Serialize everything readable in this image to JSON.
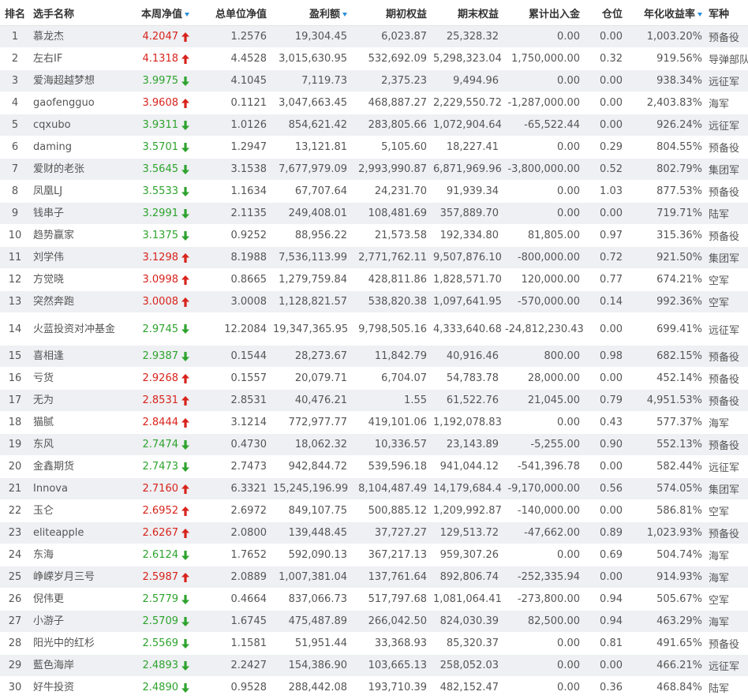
{
  "headers": {
    "rank": "排名",
    "name": "选手名称",
    "week_nav": "本周净值",
    "unit_nav": "总单位净值",
    "profit": "盈利额",
    "initial_equity": "期初权益",
    "final_equity": "期末权益",
    "cum_flow": "累计出入金",
    "position": "仓位",
    "annual_return": "年化收益率",
    "army": "军种"
  },
  "sort_icon": "sort-down-icon",
  "colors": {
    "up": "#d8231c",
    "down": "#2ea32e",
    "sort": "#2a8fd8",
    "stripe": "#eef0f3"
  },
  "rows": [
    {
      "rank": "1",
      "name": "慕龙杰",
      "week": "4.2047",
      "dir": "up",
      "unit": "1.2576",
      "profit": "19,304.45",
      "init": "6,023.87",
      "end": "25,328.32",
      "flow": "0.00",
      "pos": "0.00",
      "ann": "1,003.20%",
      "army": "预备役"
    },
    {
      "rank": "2",
      "name": "左右IF",
      "week": "4.1318",
      "dir": "up",
      "unit": "4.4528",
      "profit": "3,015,630.95",
      "init": "532,692.09",
      "end": "5,298,323.04",
      "flow": "1,750,000.00",
      "pos": "0.32",
      "ann": "919.56%",
      "army": "导弹部队"
    },
    {
      "rank": "3",
      "name": "爱海超越梦想",
      "week": "3.9975",
      "dir": "down",
      "unit": "4.1045",
      "profit": "7,119.73",
      "init": "2,375.23",
      "end": "9,494.96",
      "flow": "0.00",
      "pos": "0.00",
      "ann": "938.34%",
      "army": "远征军"
    },
    {
      "rank": "4",
      "name": "gaofengguo",
      "week": "3.9608",
      "dir": "up",
      "unit": "0.1121",
      "profit": "3,047,663.45",
      "init": "468,887.27",
      "end": "2,229,550.72",
      "flow": "-1,287,000.00",
      "pos": "0.00",
      "ann": "2,403.83%",
      "army": "海军"
    },
    {
      "rank": "5",
      "name": "cqxubo",
      "week": "3.9311",
      "dir": "down",
      "unit": "1.0126",
      "profit": "854,621.42",
      "init": "283,805.66",
      "end": "1,072,904.64",
      "flow": "-65,522.44",
      "pos": "0.00",
      "ann": "926.24%",
      "army": "远征军"
    },
    {
      "rank": "6",
      "name": "daming",
      "week": "3.5701",
      "dir": "down",
      "unit": "1.2947",
      "profit": "13,121.81",
      "init": "5,105.60",
      "end": "18,227.41",
      "flow": "0.00",
      "pos": "0.29",
      "ann": "804.55%",
      "army": "预备役"
    },
    {
      "rank": "7",
      "name": "爱财的老张",
      "week": "3.5645",
      "dir": "down",
      "unit": "3.1538",
      "profit": "7,677,979.09",
      "init": "2,993,990.87",
      "end": "6,871,969.96",
      "flow": "-3,800,000.00",
      "pos": "0.52",
      "ann": "802.79%",
      "army": "集团军"
    },
    {
      "rank": "8",
      "name": "凤凰LJ",
      "week": "3.5533",
      "dir": "down",
      "unit": "1.1634",
      "profit": "67,707.64",
      "init": "24,231.70",
      "end": "91,939.34",
      "flow": "0.00",
      "pos": "1.03",
      "ann": "877.53%",
      "army": "预备役"
    },
    {
      "rank": "9",
      "name": "钱串子",
      "week": "3.2991",
      "dir": "down",
      "unit": "2.1135",
      "profit": "249,408.01",
      "init": "108,481.69",
      "end": "357,889.70",
      "flow": "0.00",
      "pos": "0.00",
      "ann": "719.71%",
      "army": "陆军"
    },
    {
      "rank": "10",
      "name": "趋势赢家",
      "week": "3.1375",
      "dir": "down",
      "unit": "0.9252",
      "profit": "88,956.22",
      "init": "21,573.58",
      "end": "192,334.80",
      "flow": "81,805.00",
      "pos": "0.97",
      "ann": "315.36%",
      "army": "预备役"
    },
    {
      "rank": "11",
      "name": "刘学伟",
      "week": "3.1298",
      "dir": "up",
      "unit": "8.1988",
      "profit": "7,536,113.99",
      "init": "2,771,762.11",
      "end": "9,507,876.10",
      "flow": "-800,000.00",
      "pos": "0.72",
      "ann": "921.50%",
      "army": "集团军"
    },
    {
      "rank": "12",
      "name": "方觉晓",
      "week": "3.0998",
      "dir": "up",
      "unit": "0.8665",
      "profit": "1,279,759.84",
      "init": "428,811.86",
      "end": "1,828,571.70",
      "flow": "120,000.00",
      "pos": "0.77",
      "ann": "674.21%",
      "army": "空军"
    },
    {
      "rank": "13",
      "name": "突然奔跑",
      "week": "3.0008",
      "dir": "up",
      "unit": "3.0008",
      "profit": "1,128,821.57",
      "init": "538,820.38",
      "end": "1,097,641.95",
      "flow": "-570,000.00",
      "pos": "0.14",
      "ann": "992.36%",
      "army": "空军"
    },
    {
      "rank": "14",
      "name": "火蓝投资对冲基金",
      "week": "2.9745",
      "dir": "down",
      "unit": "12.2084",
      "profit": "19,347,365.95",
      "init": "9,798,505.16",
      "end": "4,333,640.68",
      "flow": "-24,812,230.43",
      "pos": "0.00",
      "ann": "699.41%",
      "army": "远征军",
      "tall": true
    },
    {
      "rank": "15",
      "name": "喜相逢",
      "week": "2.9387",
      "dir": "down",
      "unit": "0.1544",
      "profit": "28,273.67",
      "init": "11,842.79",
      "end": "40,916.46",
      "flow": "800.00",
      "pos": "0.98",
      "ann": "682.15%",
      "army": "预备役"
    },
    {
      "rank": "16",
      "name": "亏货",
      "week": "2.9268",
      "dir": "up",
      "unit": "0.1557",
      "profit": "20,079.71",
      "init": "6,704.07",
      "end": "54,783.78",
      "flow": "28,000.00",
      "pos": "0.00",
      "ann": "452.14%",
      "army": "预备役"
    },
    {
      "rank": "17",
      "name": "无为",
      "week": "2.8531",
      "dir": "up",
      "unit": "2.8531",
      "profit": "40,476.21",
      "init": "1.55",
      "end": "61,522.76",
      "flow": "21,045.00",
      "pos": "0.79",
      "ann": "4,951.53%",
      "army": "预备役"
    },
    {
      "rank": "18",
      "name": "猫腻",
      "week": "2.8444",
      "dir": "up",
      "unit": "3.1214",
      "profit": "772,977.77",
      "init": "419,101.06",
      "end": "1,192,078.83",
      "flow": "0.00",
      "pos": "0.43",
      "ann": "577.37%",
      "army": "海军"
    },
    {
      "rank": "19",
      "name": "东风",
      "week": "2.7474",
      "dir": "down",
      "unit": "0.4730",
      "profit": "18,062.32",
      "init": "10,336.57",
      "end": "23,143.89",
      "flow": "-5,255.00",
      "pos": "0.90",
      "ann": "552.13%",
      "army": "预备役"
    },
    {
      "rank": "20",
      "name": "金鑫期货",
      "week": "2.7473",
      "dir": "down",
      "unit": "2.7473",
      "profit": "942,844.72",
      "init": "539,596.18",
      "end": "941,044.12",
      "flow": "-541,396.78",
      "pos": "0.00",
      "ann": "582.44%",
      "army": "远征军"
    },
    {
      "rank": "21",
      "name": "Innova",
      "week": "2.7160",
      "dir": "up",
      "unit": "6.3321",
      "profit": "15,245,196.99",
      "init": "8,104,487.49",
      "end": "14,179,684.48",
      "flow": "-9,170,000.00",
      "pos": "0.56",
      "ann": "574.05%",
      "army": "集团军"
    },
    {
      "rank": "22",
      "name": "玉仑",
      "week": "2.6952",
      "dir": "up",
      "unit": "2.6972",
      "profit": "849,107.75",
      "init": "500,885.12",
      "end": "1,209,992.87",
      "flow": "-140,000.00",
      "pos": "0.00",
      "ann": "586.81%",
      "army": "空军"
    },
    {
      "rank": "23",
      "name": "eliteapple",
      "week": "2.6267",
      "dir": "up",
      "unit": "2.0800",
      "profit": "139,448.45",
      "init": "37,727.27",
      "end": "129,513.72",
      "flow": "-47,662.00",
      "pos": "0.89",
      "ann": "1,023.93%",
      "army": "预备役"
    },
    {
      "rank": "24",
      "name": "东海",
      "week": "2.6124",
      "dir": "down",
      "unit": "1.7652",
      "profit": "592,090.13",
      "init": "367,217.13",
      "end": "959,307.26",
      "flow": "0.00",
      "pos": "0.69",
      "ann": "504.74%",
      "army": "海军"
    },
    {
      "rank": "25",
      "name": "峥嵘岁月三号",
      "week": "2.5987",
      "dir": "up",
      "unit": "2.0889",
      "profit": "1,007,381.04",
      "init": "137,761.64",
      "end": "892,806.74",
      "flow": "-252,335.94",
      "pos": "0.00",
      "ann": "914.93%",
      "army": "海军"
    },
    {
      "rank": "26",
      "name": "倪伟更",
      "week": "2.5779",
      "dir": "down",
      "unit": "0.4664",
      "profit": "837,066.73",
      "init": "517,797.68",
      "end": "1,081,064.41",
      "flow": "-273,800.00",
      "pos": "0.94",
      "ann": "505.67%",
      "army": "空军"
    },
    {
      "rank": "27",
      "name": "小游子",
      "week": "2.5709",
      "dir": "down",
      "unit": "1.6745",
      "profit": "475,487.89",
      "init": "266,042.50",
      "end": "824,030.39",
      "flow": "82,500.00",
      "pos": "0.94",
      "ann": "463.29%",
      "army": "海军"
    },
    {
      "rank": "28",
      "name": "阳光中的红杉",
      "week": "2.5569",
      "dir": "down",
      "unit": "1.1581",
      "profit": "51,951.44",
      "init": "33,368.93",
      "end": "85,320.37",
      "flow": "0.00",
      "pos": "0.81",
      "ann": "491.65%",
      "army": "预备役"
    },
    {
      "rank": "29",
      "name": "藍色海岸",
      "week": "2.4893",
      "dir": "down",
      "unit": "2.2427",
      "profit": "154,386.90",
      "init": "103,665.13",
      "end": "258,052.03",
      "flow": "0.00",
      "pos": "0.00",
      "ann": "466.21%",
      "army": "远征军"
    },
    {
      "rank": "30",
      "name": "好牛投资",
      "week": "2.4890",
      "dir": "down",
      "unit": "0.9528",
      "profit": "288,442.08",
      "init": "193,710.39",
      "end": "482,152.47",
      "flow": "0.00",
      "pos": "0.36",
      "ann": "468.84%",
      "army": "陆军"
    }
  ]
}
